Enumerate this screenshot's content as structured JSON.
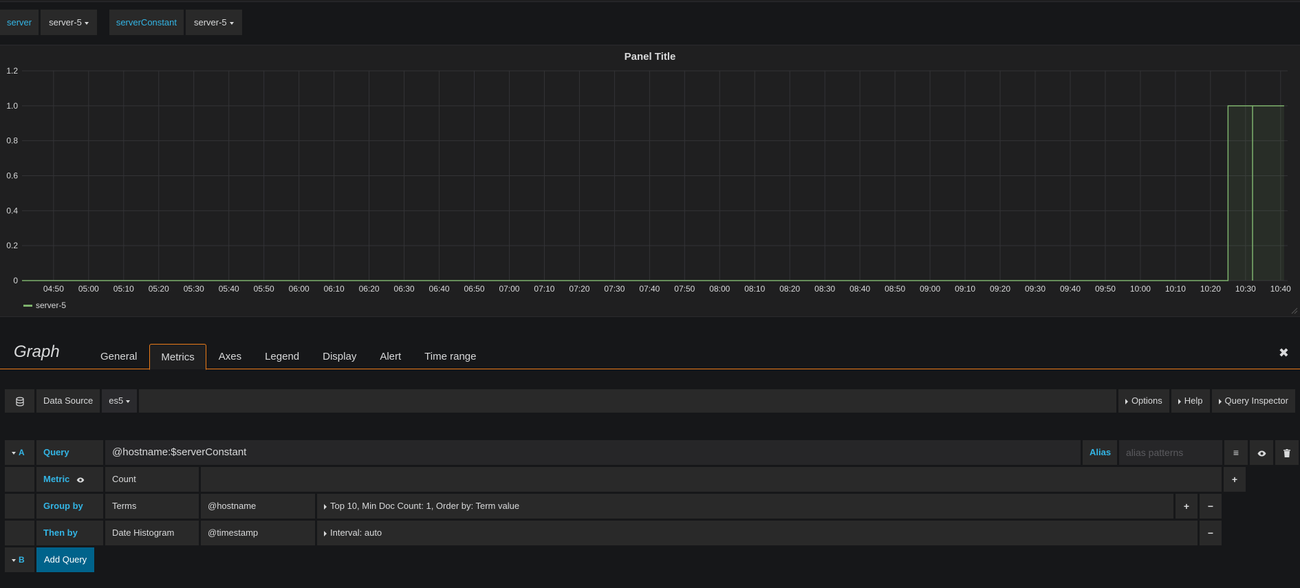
{
  "variables": [
    {
      "label": "server",
      "value": "server-5"
    },
    {
      "label": "serverConstant",
      "value": "server-5"
    }
  ],
  "panel": {
    "title": "Panel Title"
  },
  "chart_data": {
    "type": "line",
    "series": [
      {
        "name": "server-5",
        "color": "#7eb26d",
        "points": [
          [
            "04:41",
            0
          ],
          [
            "10:25",
            0
          ],
          [
            "10:25",
            1
          ],
          [
            "10:32",
            1
          ],
          [
            "10:32",
            0
          ],
          [
            "10:32",
            0
          ],
          [
            "10:32",
            1
          ],
          [
            "10:41",
            1
          ]
        ]
      }
    ],
    "y_ticks": [
      "1.2",
      "1.0",
      "0.8",
      "0.6",
      "0.4",
      "0.2",
      "0"
    ],
    "ylim": [
      0,
      1.2
    ],
    "x_ticks": [
      "04:50",
      "05:00",
      "05:10",
      "05:20",
      "05:30",
      "05:40",
      "05:50",
      "06:00",
      "06:10",
      "06:20",
      "06:30",
      "06:40",
      "06:50",
      "07:00",
      "07:10",
      "07:20",
      "07:30",
      "07:40",
      "07:50",
      "08:00",
      "08:10",
      "08:20",
      "08:30",
      "08:40",
      "08:50",
      "09:00",
      "09:10",
      "09:20",
      "09:30",
      "09:40",
      "09:50",
      "10:00",
      "10:10",
      "10:20",
      "10:30",
      "10:40"
    ],
    "xlim": [
      "04:41",
      "10:42"
    ],
    "grid": true,
    "legend": "bottom-left"
  },
  "editor": {
    "title": "Graph",
    "tabs": [
      "General",
      "Metrics",
      "Axes",
      "Legend",
      "Display",
      "Alert",
      "Time range"
    ],
    "active_tab": "Metrics",
    "close_icon": "close-icon"
  },
  "datasource": {
    "label": "Data Source",
    "value": "es5",
    "options_label": "Options",
    "help_label": "Help",
    "inspector_label": "Query Inspector"
  },
  "query_a": {
    "ref": "A",
    "query_label": "Query",
    "query_value": "@hostname:$serverConstant",
    "alias_label": "Alias",
    "alias_placeholder": "alias patterns",
    "metric_label": "Metric",
    "metric_value": "Count",
    "groupby_label": "Group by",
    "groupby_type": "Terms",
    "groupby_field": "@hostname",
    "groupby_settings": "Top 10, Min Doc Count: 1, Order by: Term value",
    "thenby_label": "Then by",
    "thenby_type": "Date Histogram",
    "thenby_field": "@timestamp",
    "thenby_settings": "Interval: auto"
  },
  "query_b": {
    "ref": "B",
    "add_label": "Add Query"
  }
}
